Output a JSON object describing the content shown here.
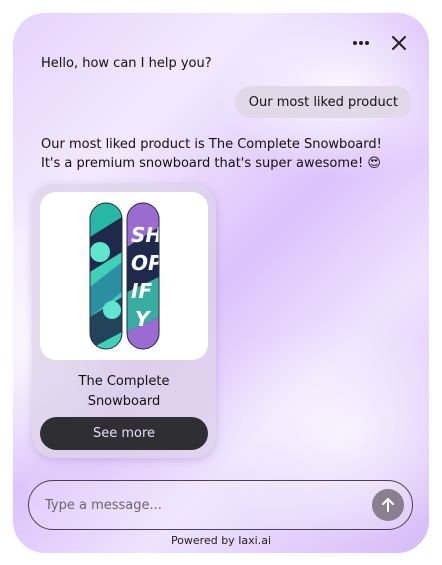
{
  "header": {
    "menu_icon": "more-horizontal-icon",
    "close_icon": "close-icon"
  },
  "messages": {
    "greeting": "Hello, how can I help you?",
    "user_message": "Our most liked product",
    "bot_line1": "Our most liked product is The Complete Snowboard!",
    "bot_line2": "It's a premium snowboard that's super awesome! 😍"
  },
  "product_card": {
    "title_line1": "The Complete",
    "title_line2": "Snowboard",
    "button_label": "See more",
    "image_icon": "snowboard-image"
  },
  "composer": {
    "placeholder": "Type a message...",
    "value": "",
    "send_icon": "arrow-up-icon"
  },
  "footer": {
    "powered_by": "Powered by Iaxi.ai"
  },
  "colors": {
    "button_bg": "#2e2e33",
    "button_text": "#e8ddff",
    "send_bg": "#8a7f8e",
    "board_teal": "#3fd0b8",
    "board_navy": "#1f2a4a",
    "board_purple": "#9a6bd0"
  }
}
